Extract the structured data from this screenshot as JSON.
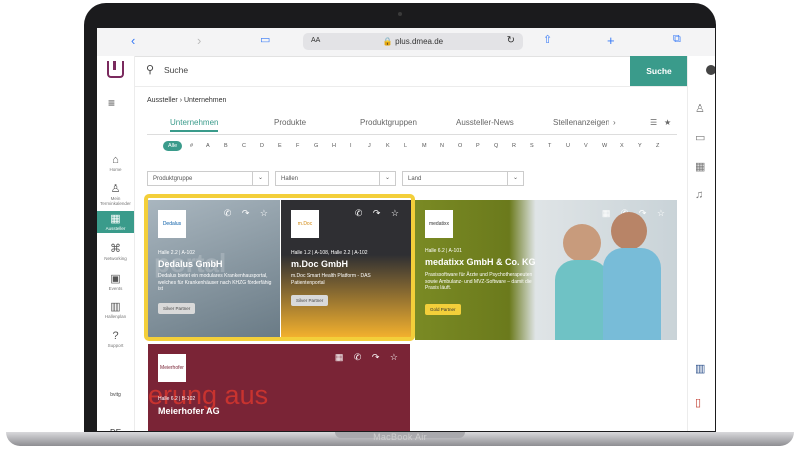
{
  "device": {
    "model": "MacBook Air"
  },
  "browser": {
    "url": "plus.dmea.de",
    "text_size": "AA"
  },
  "search": {
    "placeholder": "Suche",
    "button": "Suche"
  },
  "nav": {
    "items": [
      {
        "label": "Home"
      },
      {
        "label": "Mein Terminkalender"
      },
      {
        "label": "Aussteller"
      },
      {
        "label": "Networking"
      },
      {
        "label": "Events"
      },
      {
        "label": "Hallenplan"
      },
      {
        "label": "Support"
      }
    ],
    "partner": "bvitg",
    "language": "DE"
  },
  "breadcrumb": {
    "parent": "Aussteller",
    "sep": "›",
    "current": "Unternehmen"
  },
  "tabs": [
    "Unternehmen",
    "Produkte",
    "Produktgruppen",
    "Aussteller-News",
    "Stellenanzeigen"
  ],
  "alphabet": {
    "all": "Alle",
    "letters": [
      "#",
      "A",
      "B",
      "C",
      "D",
      "E",
      "F",
      "G",
      "H",
      "I",
      "J",
      "K",
      "L",
      "M",
      "N",
      "O",
      "P",
      "Q",
      "R",
      "S",
      "T",
      "U",
      "V",
      "W",
      "X",
      "Y",
      "Z"
    ]
  },
  "filters": [
    "Produktgruppe",
    "Hallen",
    "Land"
  ],
  "cards": [
    {
      "logo": "Dedalus",
      "hall": "Halle 2.2 | A-102",
      "name": "Dedalus GmbH",
      "desc": "Dedalus bietet ein modulares Krankenhausportal, welches für Krankenhäuser nach KHZG förderfähig ist",
      "partner": "Silver Partner",
      "bg_word": "portal",
      "bg": "#6a7b86"
    },
    {
      "logo": "m.Doc",
      "hall": "Halle 1.2 | A-108, Halle 2.2 | A-102",
      "name": "m.Doc GmbH",
      "desc": "m.Doc Smart Health Platform - DAS Patientenportal",
      "partner": "Silver Partner",
      "bg": "#2f2f33"
    },
    {
      "logo": "medatixx",
      "hall": "Halle 6.2 | A-101",
      "name": "medatixx GmbH & Co. KG",
      "desc": "Praxissoftware für Ärzte und Psychotherapeuten sowie Ambulanz- und MVZ-Software – damit die Praxis läuft.",
      "partner": "Gold Partner",
      "bg": "#6b7a1c"
    },
    {
      "logo": "Meierhofer",
      "hall": "Halle 6.2 | B-102",
      "name": "Meierhofer AG",
      "bg_word": "erung aus",
      "bg": "#7a2436"
    }
  ],
  "colors": {
    "accent": "#3a9b8b",
    "highlight": "#f3cf3a",
    "gold": "#f3cf3a"
  }
}
